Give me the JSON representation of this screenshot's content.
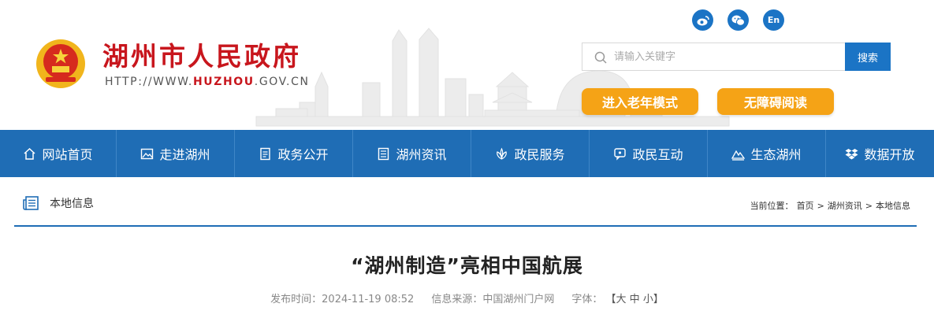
{
  "header": {
    "site_title": "湖州市人民政府",
    "url_prefix": "HTTP://WWW.",
    "url_highlight": "HUZHOU",
    "url_suffix": ".GOV.CN",
    "social": [
      {
        "icon": "weibo-icon",
        "label": ""
      },
      {
        "icon": "wechat-icon",
        "label": ""
      },
      {
        "icon": "english-icon",
        "label": "En"
      }
    ],
    "search": {
      "placeholder": "请输入关键字",
      "button": "搜索"
    },
    "elder_mode": "进入老年模式",
    "accessible_mode": "无障碍阅读",
    "accent_color": "#c8161d",
    "brand_blue": "#1f6db5",
    "pill_color": "#f5a316"
  },
  "nav": {
    "items": [
      {
        "label": "网站首页",
        "icon": "home-icon"
      },
      {
        "label": "走进湖州",
        "icon": "picture-icon"
      },
      {
        "label": "政务公开",
        "icon": "document-icon"
      },
      {
        "label": "湖州资讯",
        "icon": "news-icon"
      },
      {
        "label": "政民服务",
        "icon": "lotus-icon"
      },
      {
        "label": "政民互动",
        "icon": "chat-icon"
      },
      {
        "label": "生态湖州",
        "icon": "mountain-icon"
      },
      {
        "label": "数据开放",
        "icon": "dropbox-icon"
      }
    ]
  },
  "section": {
    "title": "本地信息",
    "breadcrumb_prefix": "当前位置：",
    "breadcrumb": [
      "首页",
      "湖州资讯",
      "本地信息"
    ],
    "separator": ">"
  },
  "article": {
    "title": "“湖州制造”亮相中国航展",
    "publish_label": "发布时间：",
    "publish_time": "2024-11-19 08:52",
    "source_label": "信息来源：",
    "source": "中国湖州门户网",
    "font_label": "字体：",
    "font_open": "【",
    "font_large": "大",
    "font_medium": "中",
    "font_small": "小",
    "font_close": "】"
  }
}
